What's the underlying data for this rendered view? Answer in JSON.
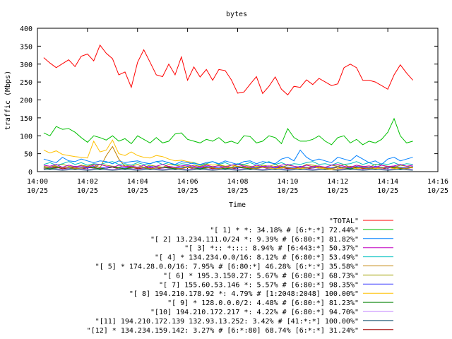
{
  "chart_data": {
    "type": "line",
    "title": "bytes",
    "xlabel": "Time",
    "ylabel": "traffic (Mbps)",
    "ylim": [
      0,
      400
    ],
    "xlim": [
      "14:00",
      "14:16"
    ],
    "grid": false,
    "legend_placement": "bottom",
    "y_ticks": [
      "0",
      "50",
      "100",
      "150",
      "200",
      "250",
      "300",
      "350",
      "400"
    ],
    "x_ticks": [
      {
        "time": "14:00",
        "date": "10/25"
      },
      {
        "time": "14:02",
        "date": "10/25"
      },
      {
        "time": "14:04",
        "date": "10/25"
      },
      {
        "time": "14:06",
        "date": "10/25"
      },
      {
        "time": "14:08",
        "date": "10/25"
      },
      {
        "time": "14:10",
        "date": "10/25"
      },
      {
        "time": "14:12",
        "date": "10/25"
      },
      {
        "time": "14:14",
        "date": "10/25"
      },
      {
        "time": "14:16",
        "date": "10/25"
      }
    ],
    "x": [
      "14:00:15",
      "14:00:30",
      "14:00:45",
      "14:01:00",
      "14:01:15",
      "14:01:30",
      "14:01:45",
      "14:02:00",
      "14:02:15",
      "14:02:30",
      "14:02:45",
      "14:03:00",
      "14:03:15",
      "14:03:30",
      "14:03:45",
      "14:04:00",
      "14:04:15",
      "14:04:30",
      "14:04:45",
      "14:05:00",
      "14:05:15",
      "14:05:30",
      "14:05:45",
      "14:06:00",
      "14:06:15",
      "14:06:30",
      "14:06:45",
      "14:07:00",
      "14:07:15",
      "14:07:30",
      "14:07:45",
      "14:08:00",
      "14:08:15",
      "14:08:30",
      "14:08:45",
      "14:09:00",
      "14:09:15",
      "14:09:30",
      "14:09:45",
      "14:10:00",
      "14:10:15",
      "14:10:30",
      "14:10:45",
      "14:11:00",
      "14:11:15",
      "14:11:30",
      "14:11:45",
      "14:12:00",
      "14:12:15",
      "14:12:30",
      "14:12:45",
      "14:13:00",
      "14:13:15",
      "14:13:30",
      "14:13:45",
      "14:14:00",
      "14:14:15",
      "14:14:30",
      "14:14:45",
      "14:15:00"
    ],
    "series": [
      {
        "name": "\"TOTAL\"",
        "color": "#ff0000",
        "values": [
          318,
          303,
          290,
          301,
          312,
          293,
          322,
          328,
          309,
          353,
          330,
          315,
          270,
          278,
          235,
          305,
          340,
          305,
          270,
          265,
          300,
          270,
          320,
          255,
          292,
          264,
          285,
          255,
          285,
          282,
          256,
          219,
          222,
          244,
          265,
          218,
          238,
          264,
          230,
          214,
          238,
          235,
          256,
          243,
          260,
          250,
          240,
          245,
          290,
          300,
          290,
          255,
          255,
          250,
          240,
          230,
          270,
          298,
          275,
          255
        ]
      },
      {
        "name": "\"[ 1] * *: 34.18% # [6:*:*] 72.44%\"",
        "color": "#00c000",
        "values": [
          108,
          100,
          126,
          118,
          120,
          110,
          95,
          82,
          100,
          95,
          88,
          100,
          85,
          92,
          78,
          100,
          90,
          80,
          95,
          80,
          85,
          105,
          108,
          90,
          85,
          80,
          90,
          85,
          95,
          80,
          85,
          78,
          100,
          98,
          80,
          85,
          100,
          95,
          78,
          120,
          95,
          85,
          85,
          90,
          100,
          85,
          75,
          95,
          100,
          80,
          90,
          75,
          85,
          80,
          90,
          110,
          148,
          100,
          80,
          85
        ]
      },
      {
        "name": "\"[ 2] 13.234.111.0/24 *: 9.39% # [6:80:*] 81.82%\"",
        "color": "#0080ff",
        "values": [
          35,
          30,
          25,
          40,
          30,
          28,
          35,
          30,
          25,
          30,
          28,
          22,
          30,
          25,
          28,
          30,
          25,
          22,
          28,
          30,
          25,
          20,
          28,
          25,
          22,
          20,
          25,
          28,
          22,
          30,
          25,
          20,
          28,
          30,
          22,
          28,
          25,
          22,
          35,
          40,
          30,
          60,
          40,
          30,
          35,
          30,
          25,
          40,
          35,
          30,
          45,
          35,
          25,
          30,
          20,
          35,
          40,
          30,
          35,
          40
        ]
      },
      {
        "name": "\"[ 3] *:: *:::: 8.94% # [6:443:*] 50.37%\"",
        "color": "#c000c0",
        "values": [
          18,
          15,
          20,
          12,
          18,
          14,
          16,
          12,
          18,
          20,
          15,
          12,
          18,
          14,
          16,
          12,
          18,
          10,
          15,
          20,
          14,
          12,
          16,
          18,
          15,
          12,
          18,
          14,
          16,
          12,
          18,
          20,
          15,
          12,
          18,
          14,
          16,
          12,
          18,
          20,
          15,
          12,
          18,
          14,
          16,
          12,
          18,
          20,
          15,
          12,
          18,
          14,
          16,
          12,
          18,
          14,
          16,
          20,
          15,
          18
        ]
      },
      {
        "name": "\"[ 4] * 134.234.0.0/16: 8.12% # [6:80:*] 53.49%\"",
        "color": "#00c0c0",
        "values": [
          20,
          25,
          18,
          22,
          28,
          20,
          25,
          18,
          22,
          20,
          25,
          28,
          20,
          22,
          18,
          25,
          20,
          22,
          28,
          20,
          25,
          18,
          22,
          20,
          25,
          18,
          22,
          28,
          20,
          25,
          18,
          22,
          20,
          25,
          18,
          22,
          28,
          20,
          25,
          18,
          22,
          20,
          25,
          28,
          20,
          22,
          18,
          25,
          20,
          22,
          28,
          20,
          25,
          18,
          22,
          20,
          25,
          18,
          22,
          20
        ]
      },
      {
        "name": "\"[ 5] * 174.28.0.0/16: 7.95% # [6:80:*] 46.28% [6:*:*] 35.58%\"",
        "color": "#c08000",
        "values": [
          10,
          12,
          15,
          10,
          12,
          8,
          10,
          15,
          20,
          10,
          45,
          70,
          35,
          15,
          12,
          10,
          12,
          8,
          10,
          12,
          15,
          10,
          8,
          12,
          10,
          15,
          12,
          10,
          8,
          12,
          10,
          15,
          12,
          10,
          8,
          12,
          10,
          15,
          12,
          10,
          8,
          12,
          10,
          15,
          12,
          10,
          8,
          12,
          10,
          15,
          12,
          10,
          8,
          12,
          10,
          15,
          12,
          10,
          8,
          12
        ]
      },
      {
        "name": "\"[ 6] * 195.3.150.27: 5.67% # [6:80:*] 68.73%\"",
        "color": "#a0a000",
        "values": [
          15,
          12,
          18,
          20,
          15,
          12,
          18,
          15,
          12,
          20,
          18,
          15,
          12,
          18,
          15,
          20,
          12,
          18,
          15,
          12,
          20,
          18,
          15,
          12,
          18,
          15,
          20,
          12,
          18,
          15,
          12,
          20,
          18,
          15,
          12,
          18,
          15,
          20,
          12,
          18,
          15,
          12,
          20,
          18,
          15,
          12,
          18,
          15,
          20,
          12,
          18,
          15,
          12,
          20,
          18,
          15,
          12,
          18,
          15,
          12
        ]
      },
      {
        "name": "\"[ 7] 155.60.53.146 *: 5.57% # [6:80:*] 98.35%\"",
        "color": "#4040ff",
        "values": [
          12,
          10,
          15,
          12,
          10,
          15,
          12,
          10,
          15,
          12,
          10,
          15,
          12,
          10,
          15,
          12,
          10,
          15,
          12,
          10,
          15,
          12,
          10,
          15,
          12,
          10,
          15,
          12,
          10,
          15,
          12,
          10,
          15,
          12,
          10,
          15,
          12,
          10,
          15,
          12,
          10,
          15,
          12,
          10,
          15,
          12,
          10,
          15,
          12,
          10,
          15,
          12,
          10,
          15,
          12,
          10,
          15,
          12,
          10,
          15
        ]
      },
      {
        "name": "\"[ 8] 194.210.178.92 *: 4.79% # [1:2048:2048] 100.00%\"",
        "color": "#ffc000",
        "values": [
          60,
          52,
          58,
          48,
          45,
          42,
          40,
          38,
          85,
          55,
          60,
          88,
          50,
          45,
          55,
          45,
          40,
          38,
          45,
          42,
          35,
          30,
          32,
          28,
          25,
          20,
          22,
          18,
          20,
          15,
          18,
          15,
          12,
          10,
          15,
          12,
          10,
          8,
          10,
          12,
          10,
          8,
          10,
          12,
          10,
          8,
          5,
          8,
          10,
          12,
          8,
          10,
          12,
          8,
          10,
          12,
          8,
          10,
          12,
          10
        ]
      },
      {
        "name": "\"[ 9] * 128.0.0.0/2: 4.48% # [6:80:*] 81.23%\"",
        "color": "#008000",
        "values": [
          10,
          8,
          10,
          12,
          10,
          8,
          10,
          12,
          10,
          8,
          10,
          12,
          10,
          8,
          10,
          12,
          10,
          8,
          10,
          12,
          10,
          8,
          10,
          12,
          10,
          8,
          10,
          12,
          10,
          8,
          10,
          12,
          10,
          8,
          10,
          12,
          10,
          8,
          10,
          12,
          10,
          8,
          10,
          12,
          10,
          8,
          10,
          12,
          10,
          8,
          10,
          12,
          10,
          8,
          10,
          12,
          10,
          8,
          10,
          12
        ]
      },
      {
        "name": "\"[10] 194.210.172.217 *: 4.22% # [6:80:*] 94.70%\"",
        "color": "#c080ff",
        "values": [
          8,
          10,
          8,
          6,
          8,
          10,
          8,
          6,
          8,
          10,
          8,
          6,
          8,
          10,
          8,
          6,
          8,
          10,
          8,
          6,
          8,
          10,
          8,
          6,
          8,
          10,
          8,
          6,
          8,
          10,
          8,
          6,
          8,
          10,
          8,
          6,
          8,
          10,
          8,
          6,
          8,
          10,
          8,
          6,
          8,
          10,
          8,
          6,
          8,
          10,
          8,
          6,
          8,
          10,
          8,
          6,
          8,
          10,
          8,
          6
        ]
      },
      {
        "name": "\"[11] 194.210.172.139 132.93.13.252: 3.42% # [41:*:*] 100.00%\"",
        "color": "#004060",
        "values": [
          5,
          6,
          5,
          4,
          5,
          6,
          5,
          4,
          5,
          6,
          5,
          4,
          5,
          6,
          5,
          4,
          5,
          6,
          5,
          4,
          5,
          6,
          5,
          4,
          5,
          6,
          5,
          4,
          5,
          6,
          5,
          4,
          5,
          6,
          5,
          4,
          5,
          6,
          5,
          4,
          5,
          6,
          5,
          4,
          5,
          6,
          5,
          4,
          5,
          6,
          5,
          4,
          5,
          6,
          5,
          4,
          5,
          6,
          5,
          4
        ]
      },
      {
        "name": "\"[12] * 134.234.159.142: 3.27% # [6:*:80] 68.74% [6:*:*] 31.24%\"",
        "color": "#a00000",
        "values": [
          8,
          10,
          12,
          8,
          10,
          12,
          8,
          10,
          12,
          8,
          10,
          12,
          8,
          10,
          12,
          8,
          10,
          12,
          8,
          10,
          12,
          8,
          10,
          12,
          8,
          10,
          12,
          8,
          10,
          12,
          8,
          10,
          12,
          8,
          10,
          12,
          8,
          10,
          12,
          8,
          10,
          12,
          8,
          10,
          12,
          8,
          10,
          12,
          8,
          10,
          12,
          8,
          10,
          12,
          8,
          10,
          12,
          8,
          10,
          12
        ]
      }
    ]
  }
}
